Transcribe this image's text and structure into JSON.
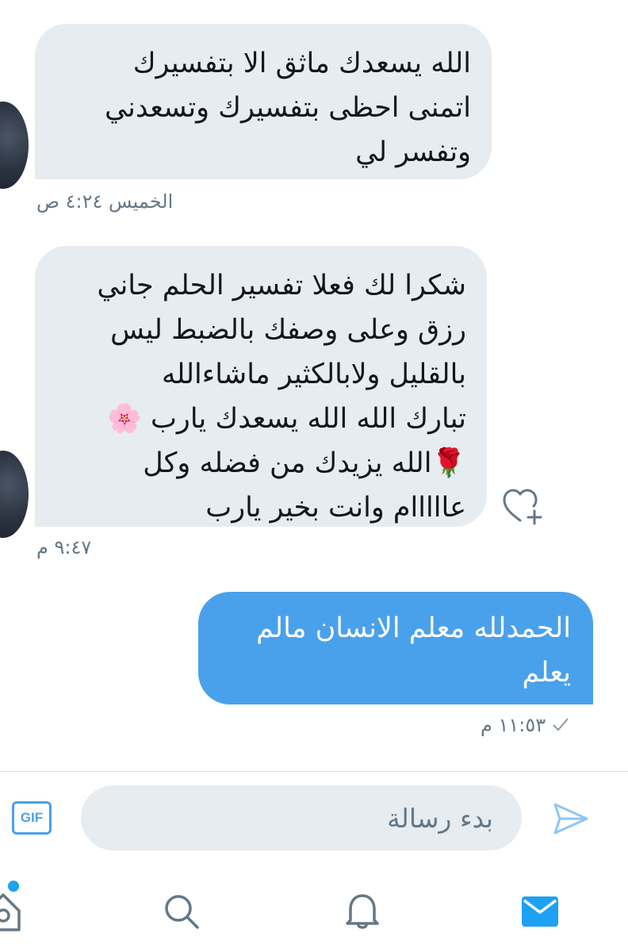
{
  "conversation": {
    "messages": [
      {
        "direction": "incoming",
        "text": "الله يسعدك ماثق الا بتفسيرك\nاتمنى احظى بتفسيرك وتسعدني\nوتفسر لي",
        "timestamp": "الخميس ٤:٢٤ ص"
      },
      {
        "direction": "incoming",
        "text": "شكرا لك فعلا تفسير الحلم جاني\nرزق وعلى وصفك بالضبط ليس\nبالقليل  ولابالكثير ماشاءالله\nتبارك الله الله يسعدك يارب 🌸\n🌹الله يزيدك من فضله وكل\nعااااام وانت بخير يارب",
        "timestamp": "٩:٤٧ م"
      },
      {
        "direction": "outgoing",
        "text": "الحمدلله معلم الانسان مالم\nيعلم",
        "timestamp": "١١:٥٣ م",
        "status_icon": "checkmark-icon"
      }
    ],
    "reaction_icon": "heart-add-icon"
  },
  "composer": {
    "gif_label": "GIF",
    "placeholder": "بدء رسالة",
    "send_icon": "send-icon"
  },
  "tab_bar": {
    "items": [
      {
        "icon": "home-icon",
        "has_notification_dot": true
      },
      {
        "icon": "search-icon"
      },
      {
        "icon": "bell-icon"
      },
      {
        "icon": "mail-icon",
        "active": true
      }
    ]
  },
  "colors": {
    "accent": "#1da1f2",
    "outgoing_bubble": "#4aa1eb",
    "incoming_bubble": "#e6ecf0",
    "timestamp": "#657786"
  }
}
